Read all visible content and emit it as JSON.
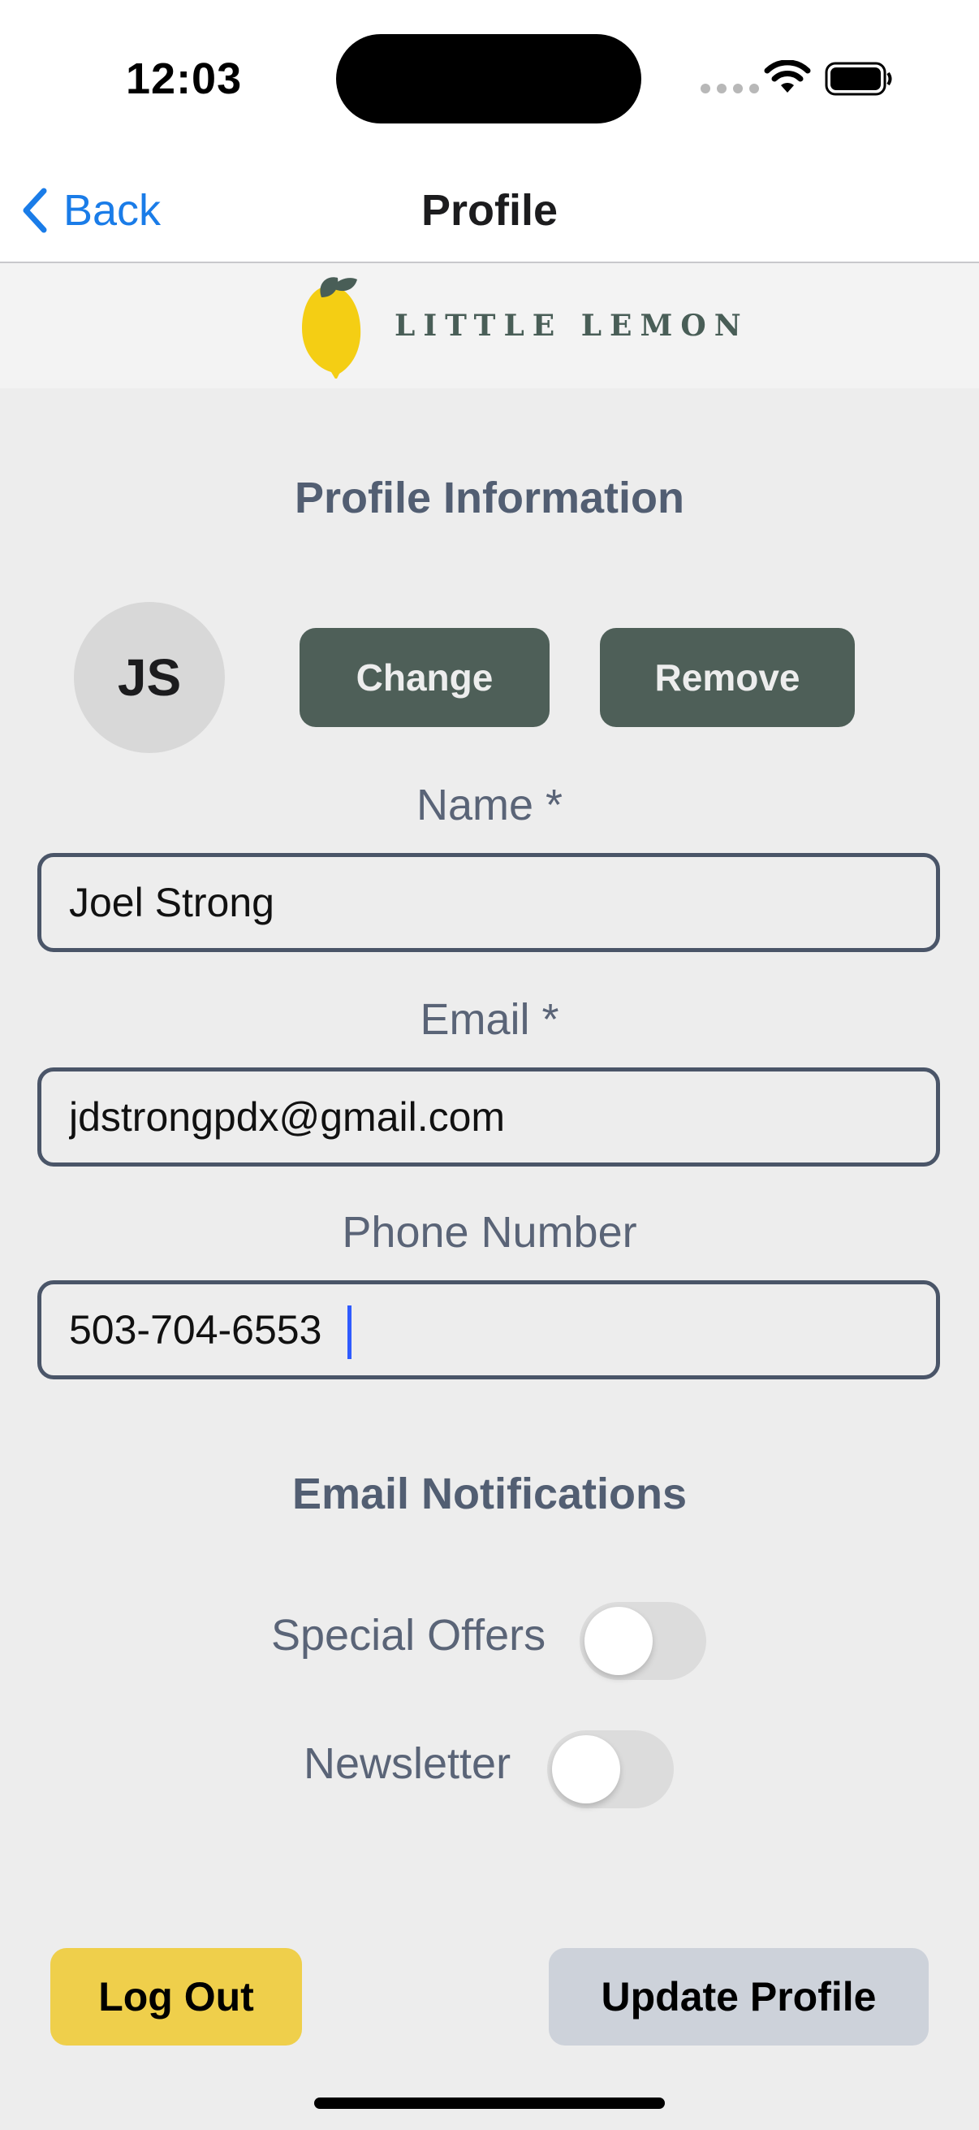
{
  "status_bar": {
    "time": "12:03"
  },
  "nav": {
    "back_label": "Back",
    "title": "Profile"
  },
  "brand": {
    "logo_text": "LITTLE LEMON",
    "accent": "#F4CE14",
    "leaf": "#495E57"
  },
  "profile": {
    "section_title": "Profile Information",
    "avatar_initials": "JS",
    "change_label": "Change",
    "remove_label": "Remove"
  },
  "fields": {
    "name": {
      "label": "Name *",
      "value": "Joel Strong"
    },
    "email": {
      "label": "Email *",
      "value": "jdstrongpdx@gmail.com"
    },
    "phone": {
      "label": "Phone Number",
      "value": "503-704-6553"
    }
  },
  "notifications": {
    "section_title": "Email Notifications",
    "special_offers": {
      "label": "Special Offers",
      "on": false
    },
    "newsletter": {
      "label": "Newsletter",
      "on": false
    }
  },
  "actions": {
    "logout_label": "Log Out",
    "update_label": "Update Profile"
  },
  "colors": {
    "primary_dark": "#4E5F58",
    "yellow": "#EFCF4B",
    "link_blue": "#1A7CE8",
    "text_slate": "#525E72"
  }
}
